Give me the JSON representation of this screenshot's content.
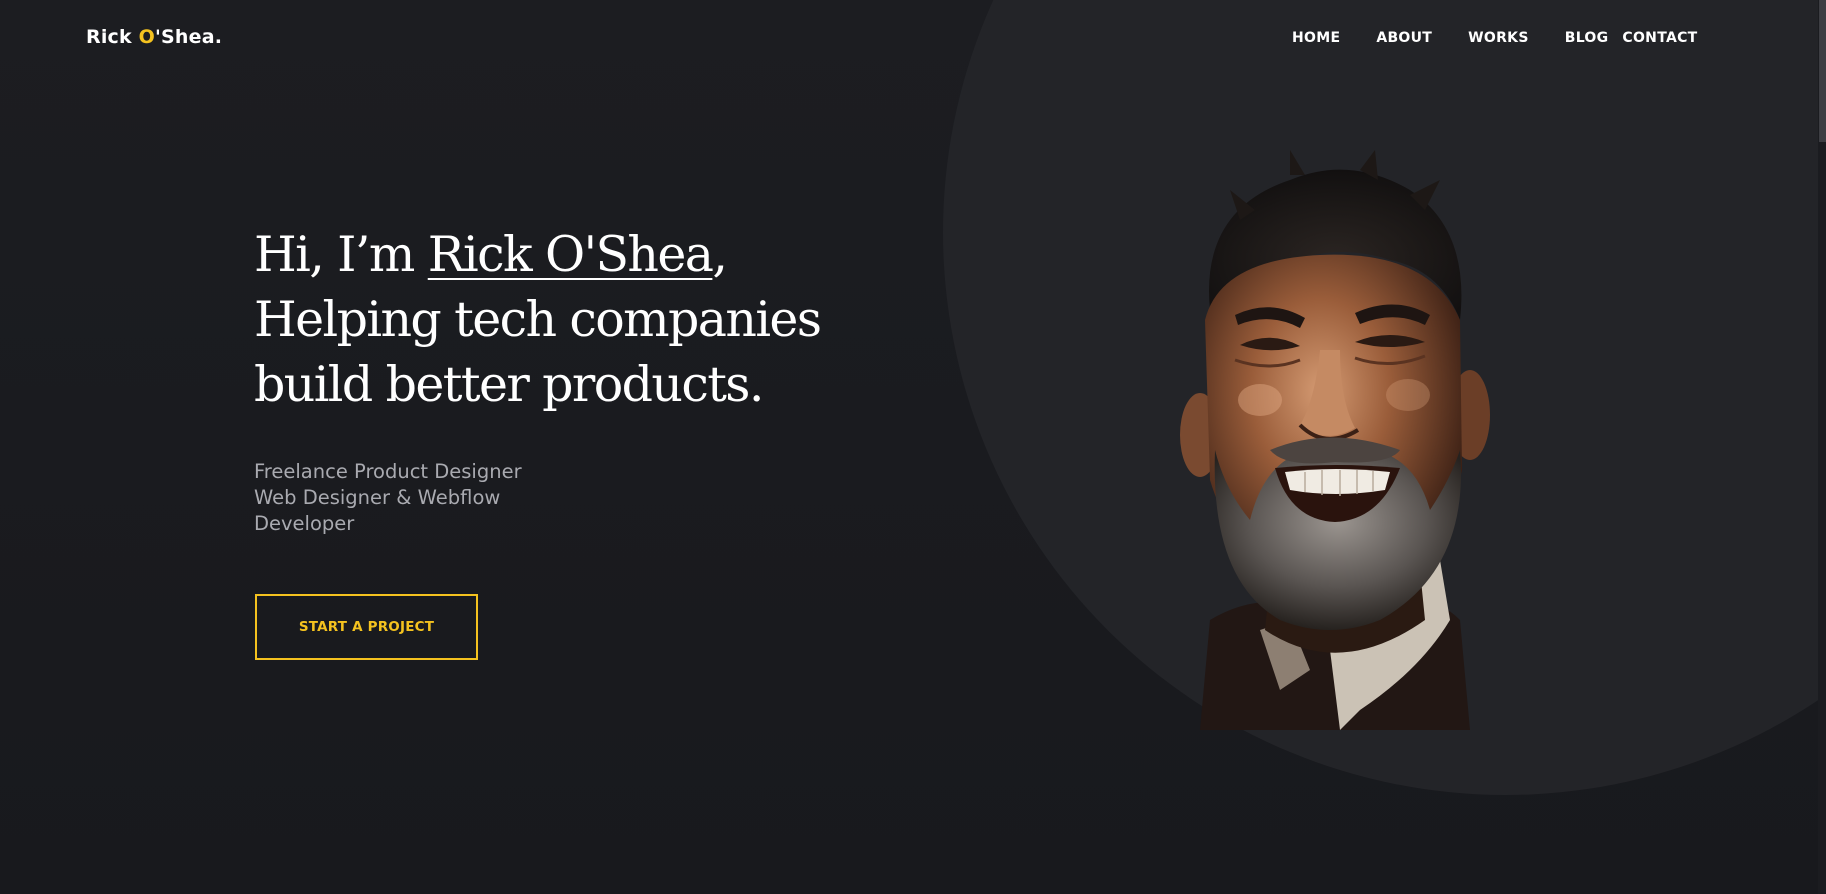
{
  "header": {
    "logo_first": "Rick ",
    "logo_accent": "O",
    "logo_rest": "'Shea.",
    "nav": [
      {
        "label": "HOME"
      },
      {
        "label": "ABOUT"
      },
      {
        "label": "WORKS"
      },
      {
        "label": "BLOG"
      },
      {
        "label": "CONTACT"
      }
    ]
  },
  "hero": {
    "title_before": "Hi, I’m ",
    "title_name": "Rick O'Shea",
    "title_after": ", Helping tech companies build better products.",
    "subtitle_lines": [
      "Freelance Product Designer",
      "Web Designer & Webflow",
      "Developer"
    ],
    "cta_label": "START A PROJECT"
  },
  "colors": {
    "background": "#1b1c20",
    "circle": "#232428",
    "accent": "#f4c21f",
    "subtitle": "#a9aab0"
  },
  "icons": {
    "portrait": "smiling-bearded-man-portrait"
  }
}
